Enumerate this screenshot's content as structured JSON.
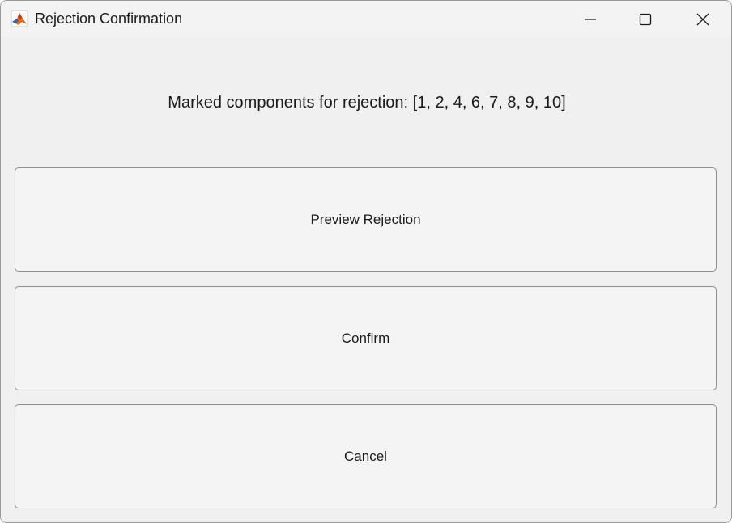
{
  "window": {
    "title": "Rejection Confirmation",
    "app_icon": "matlab-icon"
  },
  "caption_buttons": {
    "minimize_icon": "minimize-icon",
    "maximize_icon": "maximize-icon",
    "close_icon": "close-icon"
  },
  "dialog": {
    "message": "Marked components for rejection: [1, 2, 4, 6, 7, 8, 9, 10]",
    "buttons": {
      "preview_label": "Preview Rejection",
      "confirm_label": "Confirm",
      "cancel_label": "Cancel"
    }
  },
  "colors": {
    "window_background": "#f0f0f0",
    "button_background": "#f4f4f4",
    "button_border": "#8f8f8f",
    "text": "#1a1a1a"
  }
}
